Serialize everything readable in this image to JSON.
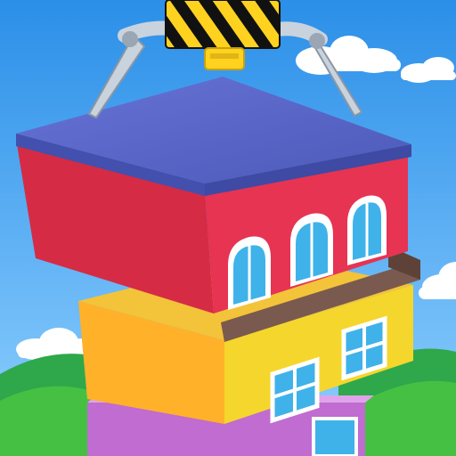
{
  "scene": {
    "title": "",
    "description": ""
  },
  "colors": {
    "sky_top": "#2b8fe8",
    "sky_bottom": "#8fd0ff",
    "cloud": "#ffffff",
    "hill_back": "#2ea84a",
    "hill_front": "#46c043",
    "top_floor_wall": "#e63452",
    "top_floor_roof": "#5b68c9",
    "middle_floor_wall": "#f5d62d",
    "middle_floor_side": "#ffb12a",
    "separator_slab": "#7a5a4e",
    "lower_floor_wall": "#c06cd0",
    "window_glass": "#3fb2ea",
    "window_frame": "#ffffff",
    "claw_metal": "#c9d3dd",
    "hazard_yellow": "#ffd21f",
    "hazard_black": "#111111"
  },
  "elements": {
    "crane_claw": "crane-claw",
    "top_floor": "top-floor-block",
    "middle_floor": "middle-floor-block",
    "lower_floor": "lower-floor-block"
  },
  "icons": {
    "arched_window": "arched-window-icon",
    "square_window": "square-window-icon",
    "cloud": "cloud-icon"
  },
  "game_state": {
    "floors_stacked": 3,
    "claw_holding_block": true
  }
}
